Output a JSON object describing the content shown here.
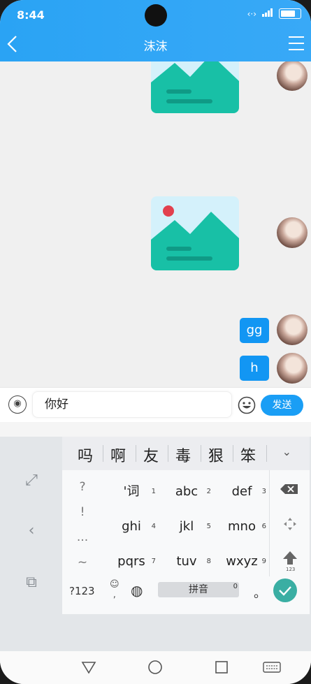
{
  "status": {
    "time": "8:44"
  },
  "header": {
    "title": "沫沫",
    "color": "#2aa3f4"
  },
  "messages": {
    "text1": "gg",
    "text2": "h"
  },
  "input": {
    "value": "你好",
    "send_label": "发送"
  },
  "keyboard": {
    "candidates": [
      "吗",
      "啊",
      "友",
      "毒",
      "狠",
      "笨"
    ],
    "punct": [
      "?",
      "!",
      "...",
      "~"
    ],
    "keys": [
      {
        "label": "'词",
        "num": "1"
      },
      {
        "label": "abc",
        "num": "2"
      },
      {
        "label": "def",
        "num": "3"
      },
      {
        "label": "ghi",
        "num": "4"
      },
      {
        "label": "jkl",
        "num": "5"
      },
      {
        "label": "mno",
        "num": "6"
      },
      {
        "label": "pqrs",
        "num": "7"
      },
      {
        "label": "tuv",
        "num": "8"
      },
      {
        "label": "wxyz",
        "num": "9"
      }
    ],
    "shift_sub": "123",
    "symbols_label": "?123",
    "emoji_sub": ",",
    "space_label": "拼音",
    "space_num": "0",
    "period": "。",
    "accent": "#3aaea3"
  }
}
